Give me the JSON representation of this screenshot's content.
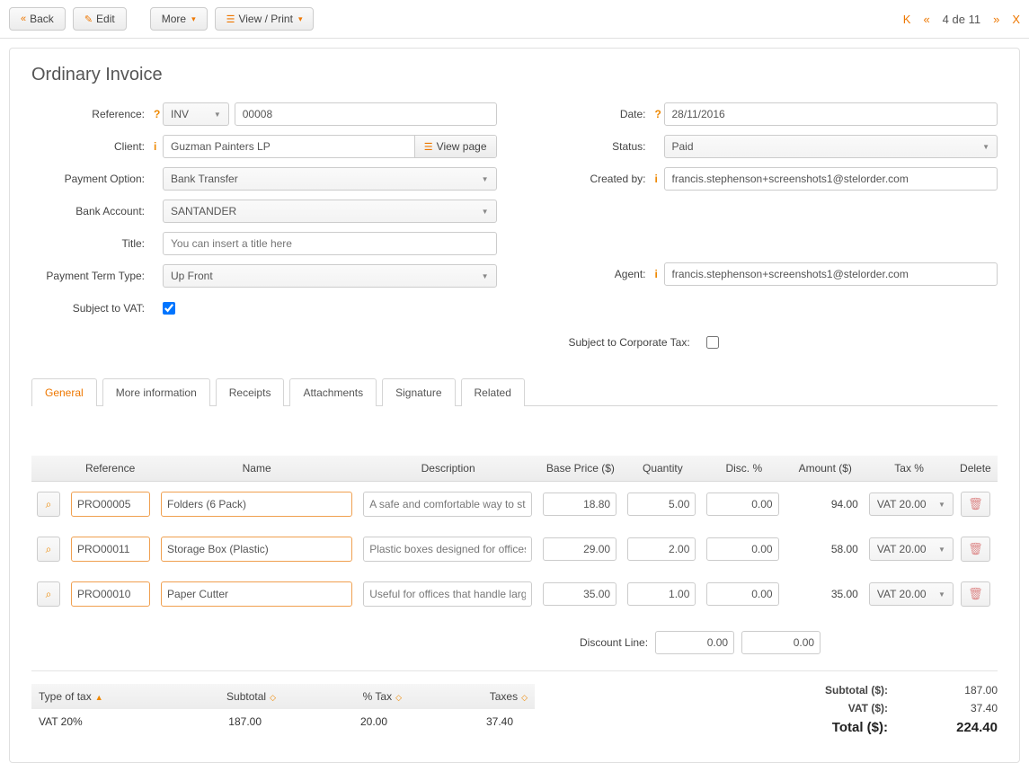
{
  "toolbar": {
    "back": "Back",
    "edit": "Edit",
    "more": "More",
    "viewprint": "View / Print"
  },
  "paginator": {
    "text": "4 de 11"
  },
  "title": "Ordinary Invoice",
  "left": {
    "reference_lbl": "Reference:",
    "ref_prefix": "INV",
    "ref_number": "00008",
    "client_lbl": "Client:",
    "client_value": "Guzman Painters LP",
    "view_page": "View page",
    "payopt_lbl": "Payment Option:",
    "payopt_value": "Bank Transfer",
    "bankacct_lbl": "Bank Account:",
    "bankacct_value": "SANTANDER",
    "title_lbl": "Title:",
    "title_placeholder": "You can insert a title here",
    "payterm_lbl": "Payment Term Type:",
    "payterm_value": "Up Front",
    "subvat_lbl": "Subject to VAT:"
  },
  "right": {
    "date_lbl": "Date:",
    "date_value": "28/11/2016",
    "status_lbl": "Status:",
    "status_value": "Paid",
    "createdby_lbl": "Created by:",
    "createdby_value": "francis.stephenson+screenshots1@stelorder.com",
    "agent_lbl": "Agent:",
    "agent_value": "francis.stephenson+screenshots1@stelorder.com",
    "corptax_lbl": "Subject to Corporate Tax:"
  },
  "tabs": {
    "general": "General",
    "more": "More information",
    "receipts": "Receipts",
    "attachments": "Attachments",
    "signature": "Signature",
    "related": "Related"
  },
  "cols": {
    "ref": "Reference",
    "name": "Name",
    "desc": "Description",
    "price": "Base Price ($)",
    "qty": "Quantity",
    "disc": "Disc. %",
    "amt": "Amount ($)",
    "tax": "Tax %",
    "del": "Delete"
  },
  "lines": [
    {
      "ref": "PRO00005",
      "name": "Folders (6 Pack)",
      "desc": "A safe and comfortable way to store",
      "price": "18.80",
      "qty": "5.00",
      "disc": "0.00",
      "amt": "94.00",
      "tax": "VAT 20.00"
    },
    {
      "ref": "PRO00011",
      "name": "Storage Box (Plastic)",
      "desc": "Plastic boxes designed for offices,",
      "price": "29.00",
      "qty": "2.00",
      "disc": "0.00",
      "amt": "58.00",
      "tax": "VAT 20.00"
    },
    {
      "ref": "PRO00010",
      "name": "Paper Cutter",
      "desc": "Useful for offices that handle large",
      "price": "35.00",
      "qty": "1.00",
      "disc": "0.00",
      "amt": "35.00",
      "tax": "VAT 20.00"
    }
  ],
  "discount": {
    "label": "Discount Line:",
    "v1": "0.00",
    "v2": "0.00"
  },
  "taxtable": {
    "h_type": "Type of tax",
    "h_sub": "Subtotal",
    "h_pct": "% Tax",
    "h_taxes": "Taxes",
    "row": {
      "type": "VAT 20%",
      "sub": "187.00",
      "pct": "20.00",
      "taxes": "37.40"
    }
  },
  "totals": {
    "sub_lbl": "Subtotal ($):",
    "sub_val": "187.00",
    "vat_lbl": "VAT ($):",
    "vat_val": "37.40",
    "total_lbl": "Total ($):",
    "total_val": "224.40"
  }
}
